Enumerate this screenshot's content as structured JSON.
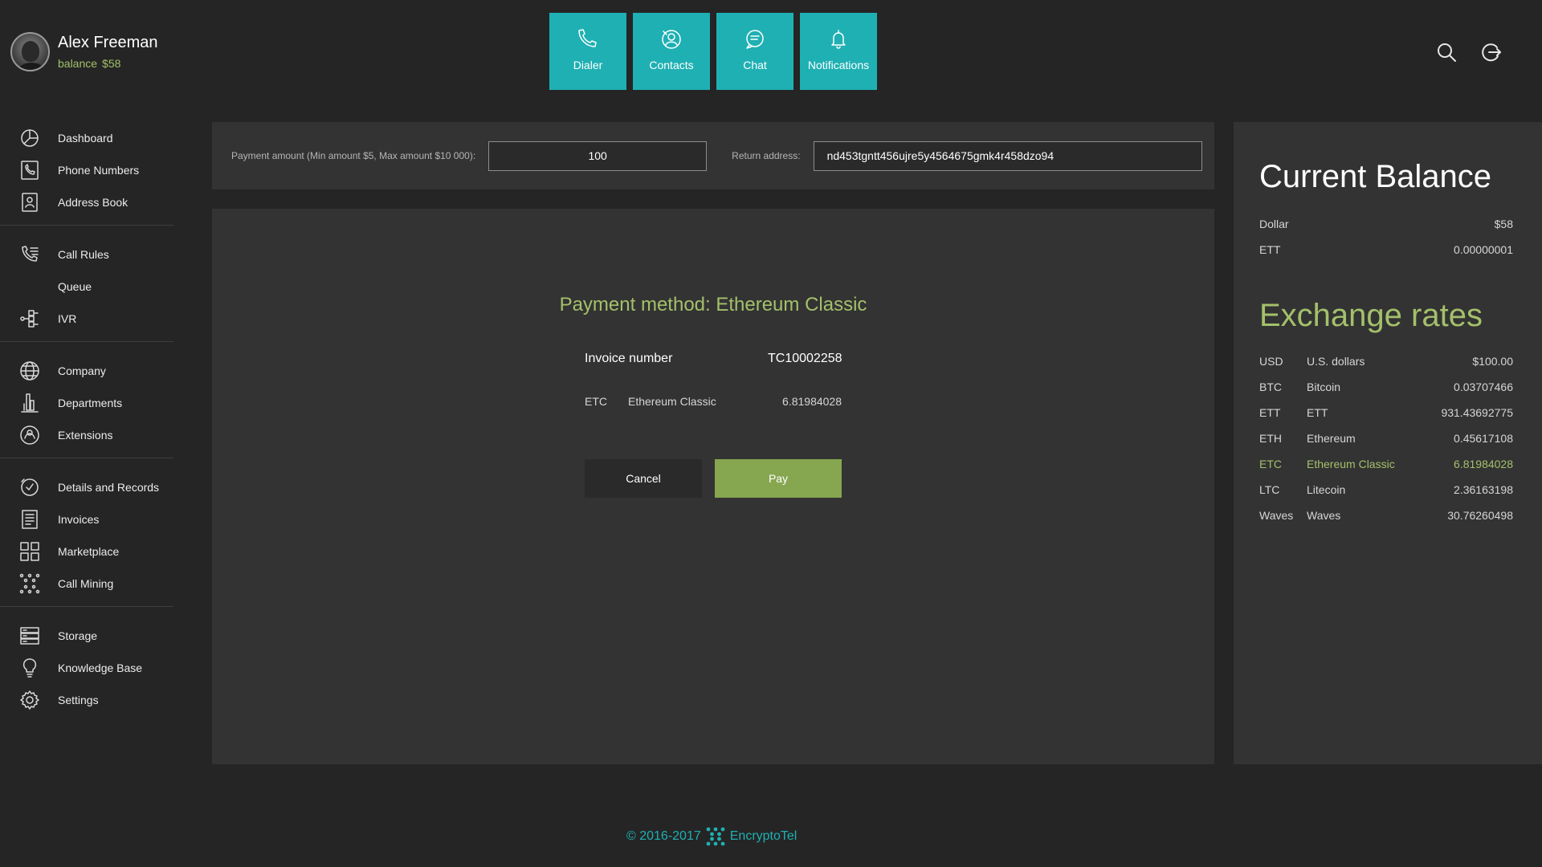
{
  "user": {
    "name": "Alex Freeman",
    "balance_label": "balance",
    "balance_value": "$58"
  },
  "sidebar": {
    "groups": [
      [
        {
          "label": "Dashboard",
          "icon": "dashboard-icon"
        },
        {
          "label": "Phone Numbers",
          "icon": "phone-numbers-icon"
        },
        {
          "label": "Address Book",
          "icon": "address-book-icon"
        }
      ],
      [
        {
          "label": "Call Rules",
          "icon": "call-rules-icon"
        },
        {
          "label": "Queue",
          "icon": ""
        },
        {
          "label": "IVR",
          "icon": "ivr-icon"
        }
      ],
      [
        {
          "label": "Company",
          "icon": "globe-icon"
        },
        {
          "label": "Departments",
          "icon": "departments-icon"
        },
        {
          "label": "Extensions",
          "icon": "extensions-icon"
        }
      ],
      [
        {
          "label": "Details and Records",
          "icon": "details-records-icon"
        },
        {
          "label": "Invoices",
          "icon": "invoices-icon"
        },
        {
          "label": "Marketplace",
          "icon": "marketplace-icon"
        },
        {
          "label": "Call Mining",
          "icon": "call-mining-icon"
        }
      ],
      [
        {
          "label": "Storage",
          "icon": "storage-icon"
        },
        {
          "label": "Knowledge Base",
          "icon": "lightbulb-icon"
        },
        {
          "label": "Settings",
          "icon": "gear-icon"
        }
      ]
    ]
  },
  "top_tiles": [
    {
      "label": "Dialer",
      "icon": "phone-icon"
    },
    {
      "label": "Contacts",
      "icon": "contacts-icon"
    },
    {
      "label": "Chat",
      "icon": "chat-icon"
    },
    {
      "label": "Notifications",
      "icon": "bell-icon"
    }
  ],
  "top_actions": {
    "search_icon": "search-icon",
    "logout_icon": "logout-icon"
  },
  "payment_bar": {
    "amount_label": "Payment amount (Min amount $5, Max amount $10 000):",
    "amount_value": "100",
    "address_label": "Return address:",
    "address_value": "nd453tgntt456ujre5y4564675gmk4r458dzo94"
  },
  "payment": {
    "method_title": "Payment method: Ethereum Classic",
    "invoice_label": "Invoice number",
    "invoice_number": "TC10002258",
    "coin_code": "ETC",
    "coin_name": "Ethereum Classic",
    "coin_amount": "6.81984028",
    "cancel_label": "Cancel",
    "pay_label": "Pay"
  },
  "balance": {
    "title": "Current Balance",
    "rows": [
      {
        "label": "Dollar",
        "value": "$58"
      },
      {
        "label": "ETT",
        "value": "0.00000001"
      }
    ]
  },
  "rates": {
    "title": "Exchange rates",
    "rows": [
      {
        "code": "USD",
        "name": "U.S. dollars",
        "value": "$100.00",
        "active": false
      },
      {
        "code": "BTC",
        "name": "Bitcoin",
        "value": "0.03707466",
        "active": false
      },
      {
        "code": "ETT",
        "name": "ETT",
        "value": "931.43692775",
        "active": false
      },
      {
        "code": "ETH",
        "name": "Ethereum",
        "value": "0.45617108",
        "active": false
      },
      {
        "code": "ETC",
        "name": "Ethereum Classic",
        "value": "6.81984028",
        "active": true
      },
      {
        "code": "LTC",
        "name": "Litecoin",
        "value": "2.36163198",
        "active": false
      },
      {
        "code": "Waves",
        "name": "Waves",
        "value": "30.76260498",
        "active": false
      }
    ]
  },
  "footer": {
    "copyright": "© 2016-2017",
    "brand": "EncryptoTel"
  },
  "colors": {
    "accent_teal": "#1fb0b3",
    "accent_green": "#a4c06b",
    "pay_green": "#87a650"
  }
}
